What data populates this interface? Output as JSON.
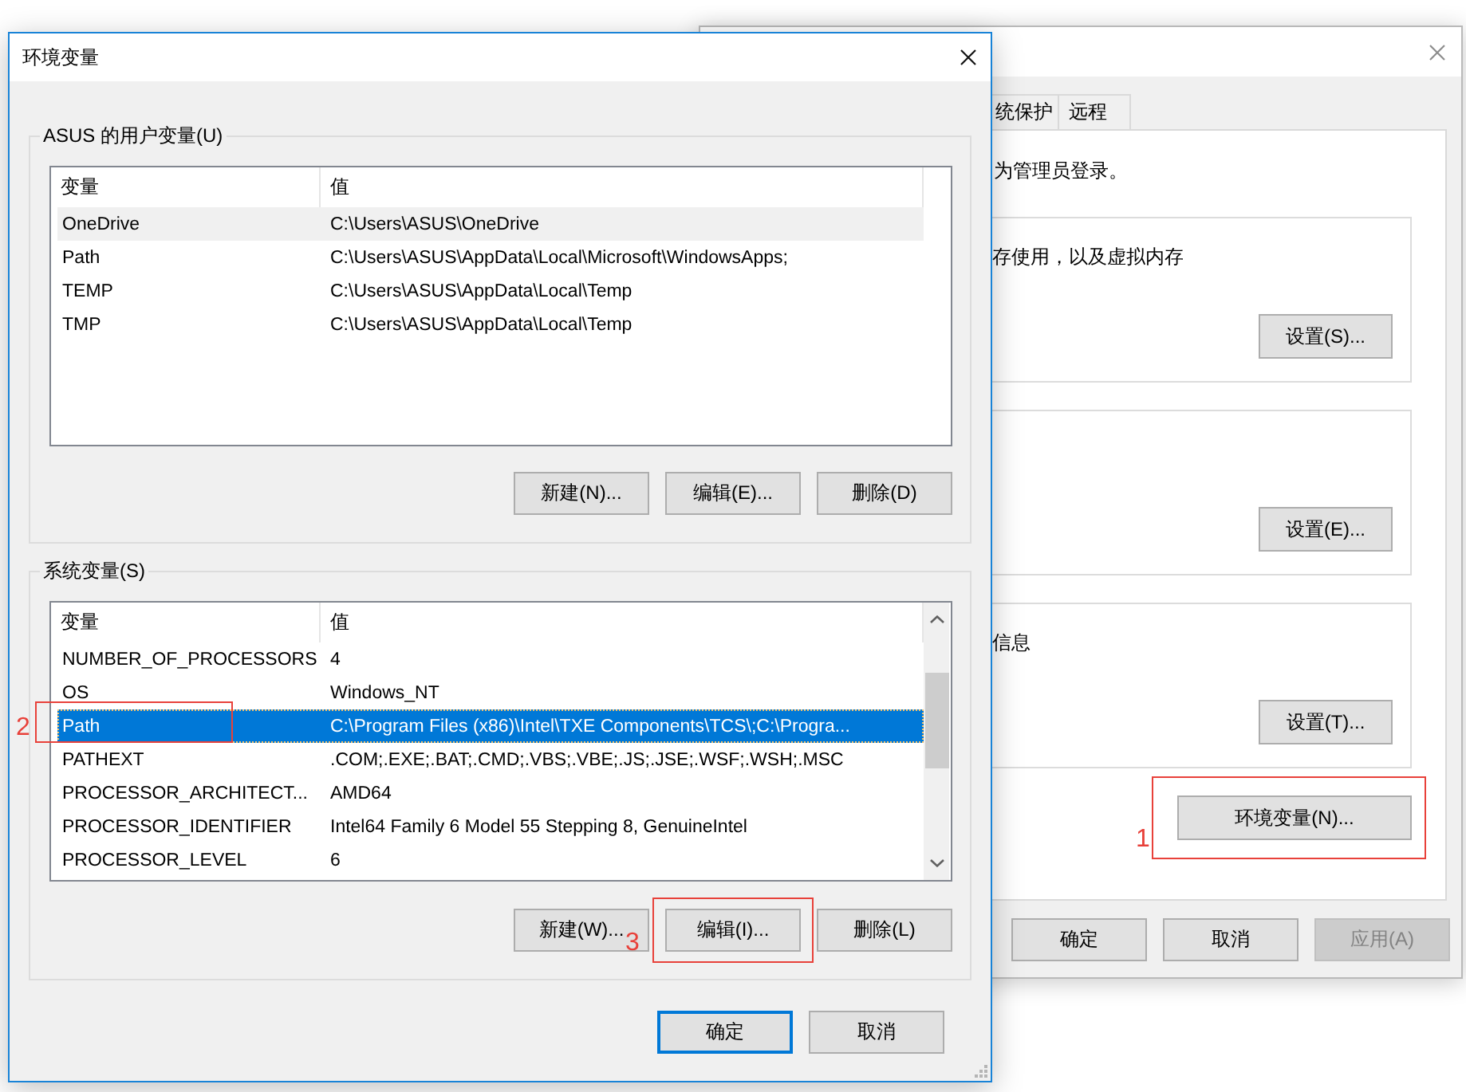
{
  "properties_window": {
    "tabs": [
      {
        "label": "统保护",
        "selected": false
      },
      {
        "label": "远程",
        "selected": false
      }
    ],
    "notice": "为管理员登录。",
    "groups": [
      {
        "text": "存使用，以及虚拟内存",
        "button": "设置(S)..."
      },
      {
        "button": "设置(E)..."
      },
      {
        "text": "信息",
        "button": "设置(T)..."
      }
    ],
    "env_button": {
      "label": "环境变量(N)...",
      "annotation": "1"
    },
    "buttons": [
      {
        "label": "确定",
        "disabled": false
      },
      {
        "label": "取消",
        "disabled": false
      },
      {
        "label": "应用(A)",
        "disabled": true
      }
    ]
  },
  "env_window": {
    "title": "环境变量",
    "user_group": {
      "label": "ASUS 的用户变量(U)",
      "focused": false,
      "columns": [
        "变量",
        "值"
      ],
      "rows": [
        {
          "name": "OneDrive",
          "value": "C:\\Users\\ASUS\\OneDrive",
          "selected": true
        },
        {
          "name": "Path",
          "value": "C:\\Users\\ASUS\\AppData\\Local\\Microsoft\\WindowsApps;",
          "selected": false
        },
        {
          "name": "TEMP",
          "value": "C:\\Users\\ASUS\\AppData\\Local\\Temp",
          "selected": false
        },
        {
          "name": "TMP",
          "value": "C:\\Users\\ASUS\\AppData\\Local\\Temp",
          "selected": false
        }
      ],
      "buttons": [
        {
          "label": "新建(N)..."
        },
        {
          "label": "编辑(E)..."
        },
        {
          "label": "删除(D)"
        }
      ]
    },
    "system_group": {
      "label": "系统变量(S)",
      "focused": true,
      "columns": [
        "变量",
        "值"
      ],
      "rows": [
        {
          "name": "NUMBER_OF_PROCESSORS",
          "value": "4",
          "selected": false
        },
        {
          "name": "OS",
          "value": "Windows_NT",
          "selected": false
        },
        {
          "name": "Path",
          "value": "C:\\Program Files (x86)\\Intel\\TXE Components\\TCS\\;C:\\Progra...",
          "selected": true,
          "annotation": "2"
        },
        {
          "name": "PATHEXT",
          "value": ".COM;.EXE;.BAT;.CMD;.VBS;.VBE;.JS;.JSE;.WSF;.WSH;.MSC",
          "selected": false
        },
        {
          "name": "PROCESSOR_ARCHITECT...",
          "value": "AMD64",
          "selected": false
        },
        {
          "name": "PROCESSOR_IDENTIFIER",
          "value": "Intel64 Family 6 Model 55 Stepping 8, GenuineIntel",
          "selected": false
        },
        {
          "name": "PROCESSOR_LEVEL",
          "value": "6",
          "selected": false
        }
      ],
      "buttons": [
        {
          "label": "新建(W)..."
        },
        {
          "label": "编辑(I)...",
          "annotation": "3"
        },
        {
          "label": "删除(L)"
        }
      ]
    },
    "buttons": [
      {
        "label": "确定",
        "default": true
      },
      {
        "label": "取消",
        "default": false
      }
    ]
  }
}
